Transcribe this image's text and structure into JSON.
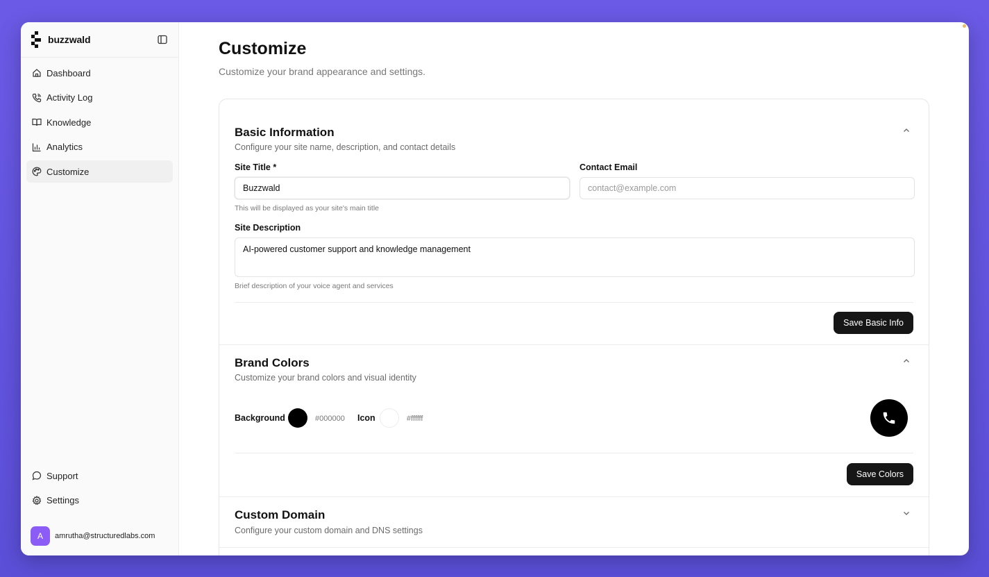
{
  "brand": {
    "name": "buzzwald"
  },
  "sidebar": {
    "items": [
      {
        "label": "Dashboard",
        "icon": "home-icon"
      },
      {
        "label": "Activity Log",
        "icon": "phone-icon"
      },
      {
        "label": "Knowledge",
        "icon": "book-icon"
      },
      {
        "label": "Analytics",
        "icon": "bar-chart-icon"
      },
      {
        "label": "Customize",
        "icon": "palette-icon",
        "active": true
      }
    ],
    "bottom_items": [
      {
        "label": "Support",
        "icon": "message-icon"
      },
      {
        "label": "Settings",
        "icon": "gear-icon"
      }
    ],
    "user": {
      "initial": "A",
      "email": "amrutha@structuredlabs.com"
    }
  },
  "page": {
    "title": "Customize",
    "subtitle": "Customize your brand appearance and settings."
  },
  "basic_info": {
    "title": "Basic Information",
    "description": "Configure your site name, description, and contact details",
    "site_title_label": "Site Title *",
    "site_title_value": "Buzzwald",
    "site_title_helper": "This will be displayed as your site's main title",
    "contact_email_label": "Contact Email",
    "contact_email_placeholder": "contact@example.com",
    "site_description_label": "Site Description",
    "site_description_value": "AI-powered customer support and knowledge management",
    "site_description_helper": "Brief description of your voice agent and services",
    "save_label": "Save Basic Info"
  },
  "brand_colors": {
    "title": "Brand Colors",
    "description": "Customize your brand colors and visual identity",
    "background_label": "Background",
    "background_hex": "#000000",
    "icon_label": "Icon",
    "icon_hex": "#ffffff",
    "save_label": "Save Colors"
  },
  "custom_domain": {
    "title": "Custom Domain",
    "description": "Configure your custom domain and DNS settings"
  },
  "colors": {
    "accent": "#161616",
    "avatar": "#8b5cf6",
    "backdrop": "#6b5ae6"
  }
}
